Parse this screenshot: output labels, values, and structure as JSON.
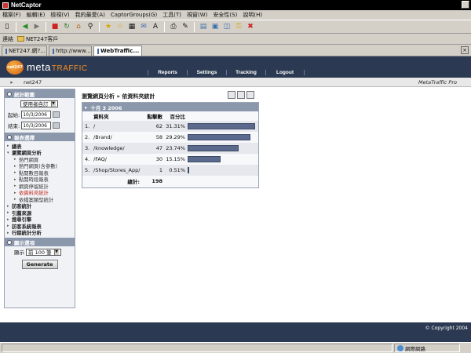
{
  "window": {
    "title": "NetCaptor"
  },
  "menu": [
    "檔案(F)",
    "編輯(E)",
    "檢視(V)",
    "我的最愛(A)",
    "CaptorGroups(G)",
    "工具(T)",
    "視窗(W)",
    "安全性(S)",
    "說明(H)"
  ],
  "links_bar": {
    "label": "連結",
    "folder": "NET247客戶"
  },
  "tabs": [
    {
      "label": "NET247.網?..."
    },
    {
      "label": "http://www...."
    },
    {
      "label": "WebTraffic..."
    }
  ],
  "site": {
    "logo_badge": "net247",
    "logo_text1": "meta",
    "logo_text2": "TRAFFIC",
    "nav": [
      "Reports",
      "Settings",
      "Tracking",
      "Logout"
    ],
    "user": "net247",
    "product": "MetaTraffic Pro"
  },
  "sidebar": {
    "date_section": "統計範圍",
    "range_select": "使用者自訂",
    "start_label": "起始:",
    "start_value": "10/3/2006",
    "end_label": "結束:",
    "end_value": "10/3/2006",
    "report_section": "報表選擇",
    "tree": [
      {
        "label": "總表",
        "level": 1
      },
      {
        "label": "瀏覽網頁分析",
        "level": 1
      },
      {
        "label": "熱門網頁",
        "level": 2
      },
      {
        "label": "熱門網頁(含參數)",
        "level": 2
      },
      {
        "label": "點閱數目報表",
        "level": 2
      },
      {
        "label": "點閱時段報表",
        "level": 2
      },
      {
        "label": "網頁停留統計",
        "level": 2
      },
      {
        "label": "依資料夾統計",
        "level": 2,
        "active": true
      },
      {
        "label": "依檔案類型統計",
        "level": 2
      },
      {
        "label": "訪客統計",
        "level": 1
      },
      {
        "label": "引薦來源",
        "level": 1
      },
      {
        "label": "搜尋引擎",
        "level": 1
      },
      {
        "label": "訪客系統報表",
        "level": 1
      },
      {
        "label": "行銷統計分析",
        "level": 1
      }
    ],
    "display_section": "顯示選項",
    "show_label": "顯示",
    "show_value": "前 100 筆",
    "generate": "Generate"
  },
  "content": {
    "breadcrumb": "瀏覽網頁分析 » 依資料夾統計",
    "date_header": "十月 3 2006",
    "col_folder": "資料夾",
    "col_hits": "點擊數",
    "col_pct": "百分比",
    "rows": [
      {
        "rank": "1.",
        "folder": "/",
        "hits": "62",
        "pct": "31.31%",
        "ratio": 0.3131
      },
      {
        "rank": "2.",
        "folder": "/Brand/",
        "hits": "58",
        "pct": "29.29%",
        "ratio": 0.2929
      },
      {
        "rank": "3.",
        "folder": "/knowledge/",
        "hits": "47",
        "pct": "23.74%",
        "ratio": 0.2374
      },
      {
        "rank": "4.",
        "folder": "/FAQ/",
        "hits": "30",
        "pct": "15.15%",
        "ratio": 0.1515
      },
      {
        "rank": "5.",
        "folder": "/Shop/Stores_App/",
        "hits": "1",
        "pct": "0.51%",
        "ratio": 0.0051
      }
    ],
    "total_label": "總計:",
    "total_value": "198"
  },
  "footer": {
    "copyright": "© Copyright 2004"
  },
  "status": {
    "zone": "網際網路"
  },
  "colors": {
    "header": "#2b3a52",
    "bar": "#5b6a8c",
    "active": "#c8271b",
    "accent": "#f08a24"
  }
}
